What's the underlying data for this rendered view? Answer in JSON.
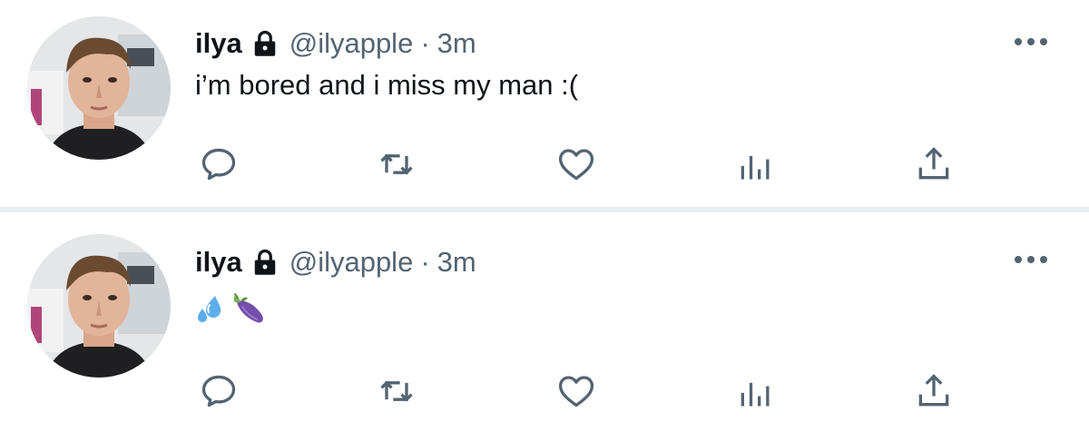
{
  "colors": {
    "text_primary": "#0f1419",
    "text_secondary": "#536471",
    "icon": "#536471",
    "divider": "#ebeef0"
  },
  "tweets": [
    {
      "name": "ilya",
      "handle": "@ilyapple",
      "separator": "·",
      "time": "3m",
      "text": "i’m bored and i miss my man :(",
      "protected_icon": "lock-icon",
      "emojis": []
    },
    {
      "name": "ilya",
      "handle": "@ilyapple",
      "separator": "·",
      "time": "3m",
      "text": "",
      "protected_icon": "lock-icon",
      "emojis": [
        "sweat-droplets-emoji",
        "eggplant-emoji"
      ]
    }
  ],
  "actions": [
    "reply-icon",
    "retweet-icon",
    "like-icon",
    "analytics-icon",
    "share-icon"
  ]
}
